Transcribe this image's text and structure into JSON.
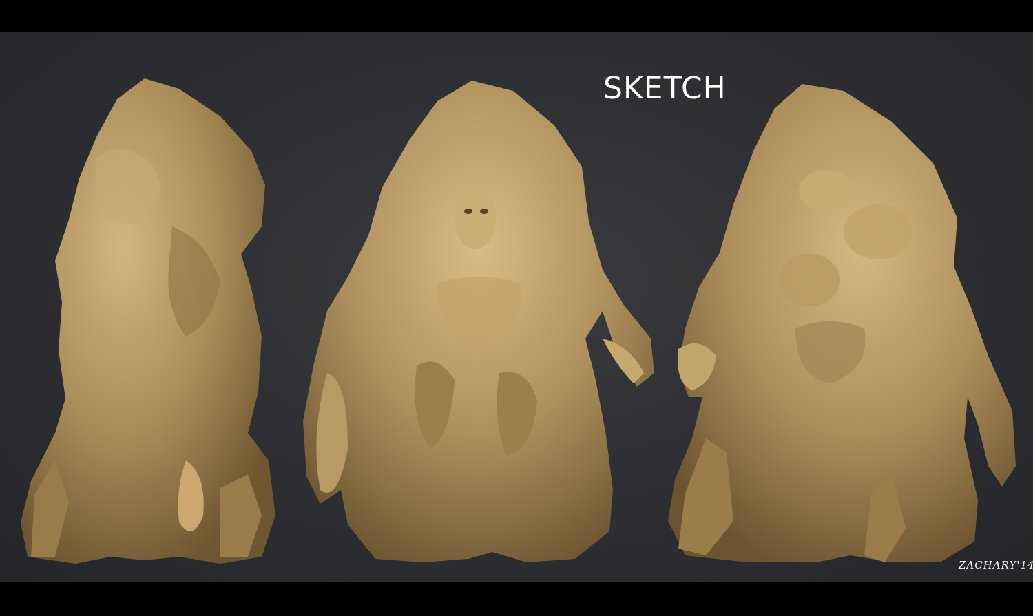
{
  "image": {
    "title": "SKETCH",
    "signature": "ZACHARY'14",
    "background_color": "#2f3033",
    "letterbox_color": "#000000",
    "sculpt_color": "#b59a66",
    "views": [
      {
        "name": "side view"
      },
      {
        "name": "front view"
      },
      {
        "name": "back view"
      }
    ]
  }
}
